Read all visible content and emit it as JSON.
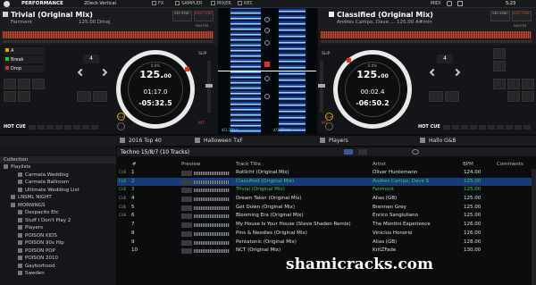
{
  "topbar": {
    "mode": "PERFORMANCE",
    "layout": "2Deck Vertical",
    "checkboxes": [
      "FX",
      "SAMPLER",
      "MIXER",
      "REC"
    ],
    "midi": "MIDI",
    "time": "5:23"
  },
  "deck_left": {
    "title": "Trivial (Original Mix)",
    "artist": "Fairmont",
    "bpm_key": "125.00 Dmaj",
    "key_sync": "KEY SYNC",
    "beat_sync": "BEAT SYNC",
    "master": "MASTER",
    "bpm_int": "125.",
    "bpm_dec": "00",
    "bpm_delta": "0.0%",
    "elapsed": "01:17.0",
    "remaining": "-05:32.5",
    "loop": "4",
    "hotcues": [
      {
        "id": "A",
        "label": "A",
        "color": "#e3a000"
      },
      {
        "id": "B",
        "label": "Break",
        "color": "#30c040"
      },
      {
        "id": "C",
        "label": "Drop",
        "color": "#d03030"
      }
    ],
    "hot_cue_label": "HOT CUE",
    "cue": "CUE",
    "slip": "SLIP",
    "mt": "MT"
  },
  "deck_right": {
    "title": "Classified (Original Mix)",
    "artist": "Andres Campo, Dave ...",
    "bpm_key": "125.00 A#min",
    "key_sync": "KEY SYNC",
    "beat_sync": "BEAT SYNC",
    "master": "MASTER",
    "bpm_int": "125.",
    "bpm_dec": "00",
    "bpm_delta": "0.0%",
    "elapsed": "00:02.4",
    "remaining": "-06:50.2",
    "loop": "4",
    "hot_cue_label": "HOT CUE",
    "cue": "CUE",
    "slip": "SLIP",
    "mt": "MT"
  },
  "waveform": {
    "beats_left": "4/1.1Bars",
    "beats_right": "4/1.1Bars"
  },
  "browser": {
    "tabs": [
      "2016 Top 40",
      "Halloween TxF",
      "Players",
      "Hallo G&B"
    ],
    "tree_header": "Collection",
    "playlists_label": "Playlists",
    "tree": [
      "Carmela Wedding",
      "Carmela Ballroom",
      "Ultimate Wedding List",
      "LNSML NIGHT",
      "MORNINGS",
      "Despacito Etc",
      "Stuff I Don't Play 2",
      "Players",
      "POISON KIDS",
      "POISON 90s Hip",
      "POISON POP",
      "POISON 2010",
      "Gayborhood",
      "Sweden"
    ],
    "playlist_title": "Techno 15/8/7 (10 Tracks)",
    "columns": {
      "num": "#",
      "preview": "Preview",
      "title": "Track Title",
      "artist": "Artist",
      "bpm": "BPM",
      "comments": "Comments"
    },
    "tracks": [
      {
        "cue": "CUE",
        "num": "1",
        "title": "Rotlicht (Original Mix)",
        "artist": "Oliver Huntemann",
        "bpm": "124.00",
        "state": ""
      },
      {
        "cue": "CUE",
        "num": "2",
        "title": "Classified (Original Mix)",
        "artist": "Andres Campo, Dave S",
        "bpm": "125.00",
        "state": "sel"
      },
      {
        "cue": "CUE",
        "num": "3",
        "title": "Trivial (Original Mix)",
        "artist": "Fairmont",
        "bpm": "125.00",
        "state": "green"
      },
      {
        "cue": "CUE",
        "num": "4",
        "title": "Dream Taker (Original Mix)",
        "artist": "Alias (GB)",
        "bpm": "125.00",
        "state": ""
      },
      {
        "cue": "CUE",
        "num": "5",
        "title": "Get Down (Original Mix)",
        "artist": "Brennen Grey",
        "bpm": "125.00",
        "state": ""
      },
      {
        "cue": "CUE",
        "num": "6",
        "title": "Blooming Era (Original Mix)",
        "artist": "Enrico Sangiuliano",
        "bpm": "125.00",
        "state": ""
      },
      {
        "cue": "",
        "num": "7",
        "title": "My House Is Your House (Steve Shaden Remix)",
        "artist": "The Montini Experience",
        "bpm": "126.00",
        "state": ""
      },
      {
        "cue": "",
        "num": "8",
        "title": "Pins & Needles (Original Mix)",
        "artist": "Vinicius Honorio",
        "bpm": "126.00",
        "state": ""
      },
      {
        "cue": "",
        "num": "9",
        "title": "Pentatonic (Original Mix)",
        "artist": "Alias (GB)",
        "bpm": "128.00",
        "state": ""
      },
      {
        "cue": "",
        "num": "10",
        "title": "NCT (Original Mix)",
        "artist": "KritZFade",
        "bpm": "130.00",
        "state": ""
      }
    ]
  },
  "watermark": "shamicracks.com",
  "colors": {
    "accent_green": "#38d04a",
    "selection": "#173a7a",
    "marker_red": "#e0321e",
    "waveform_blue": "#3d8cff"
  }
}
